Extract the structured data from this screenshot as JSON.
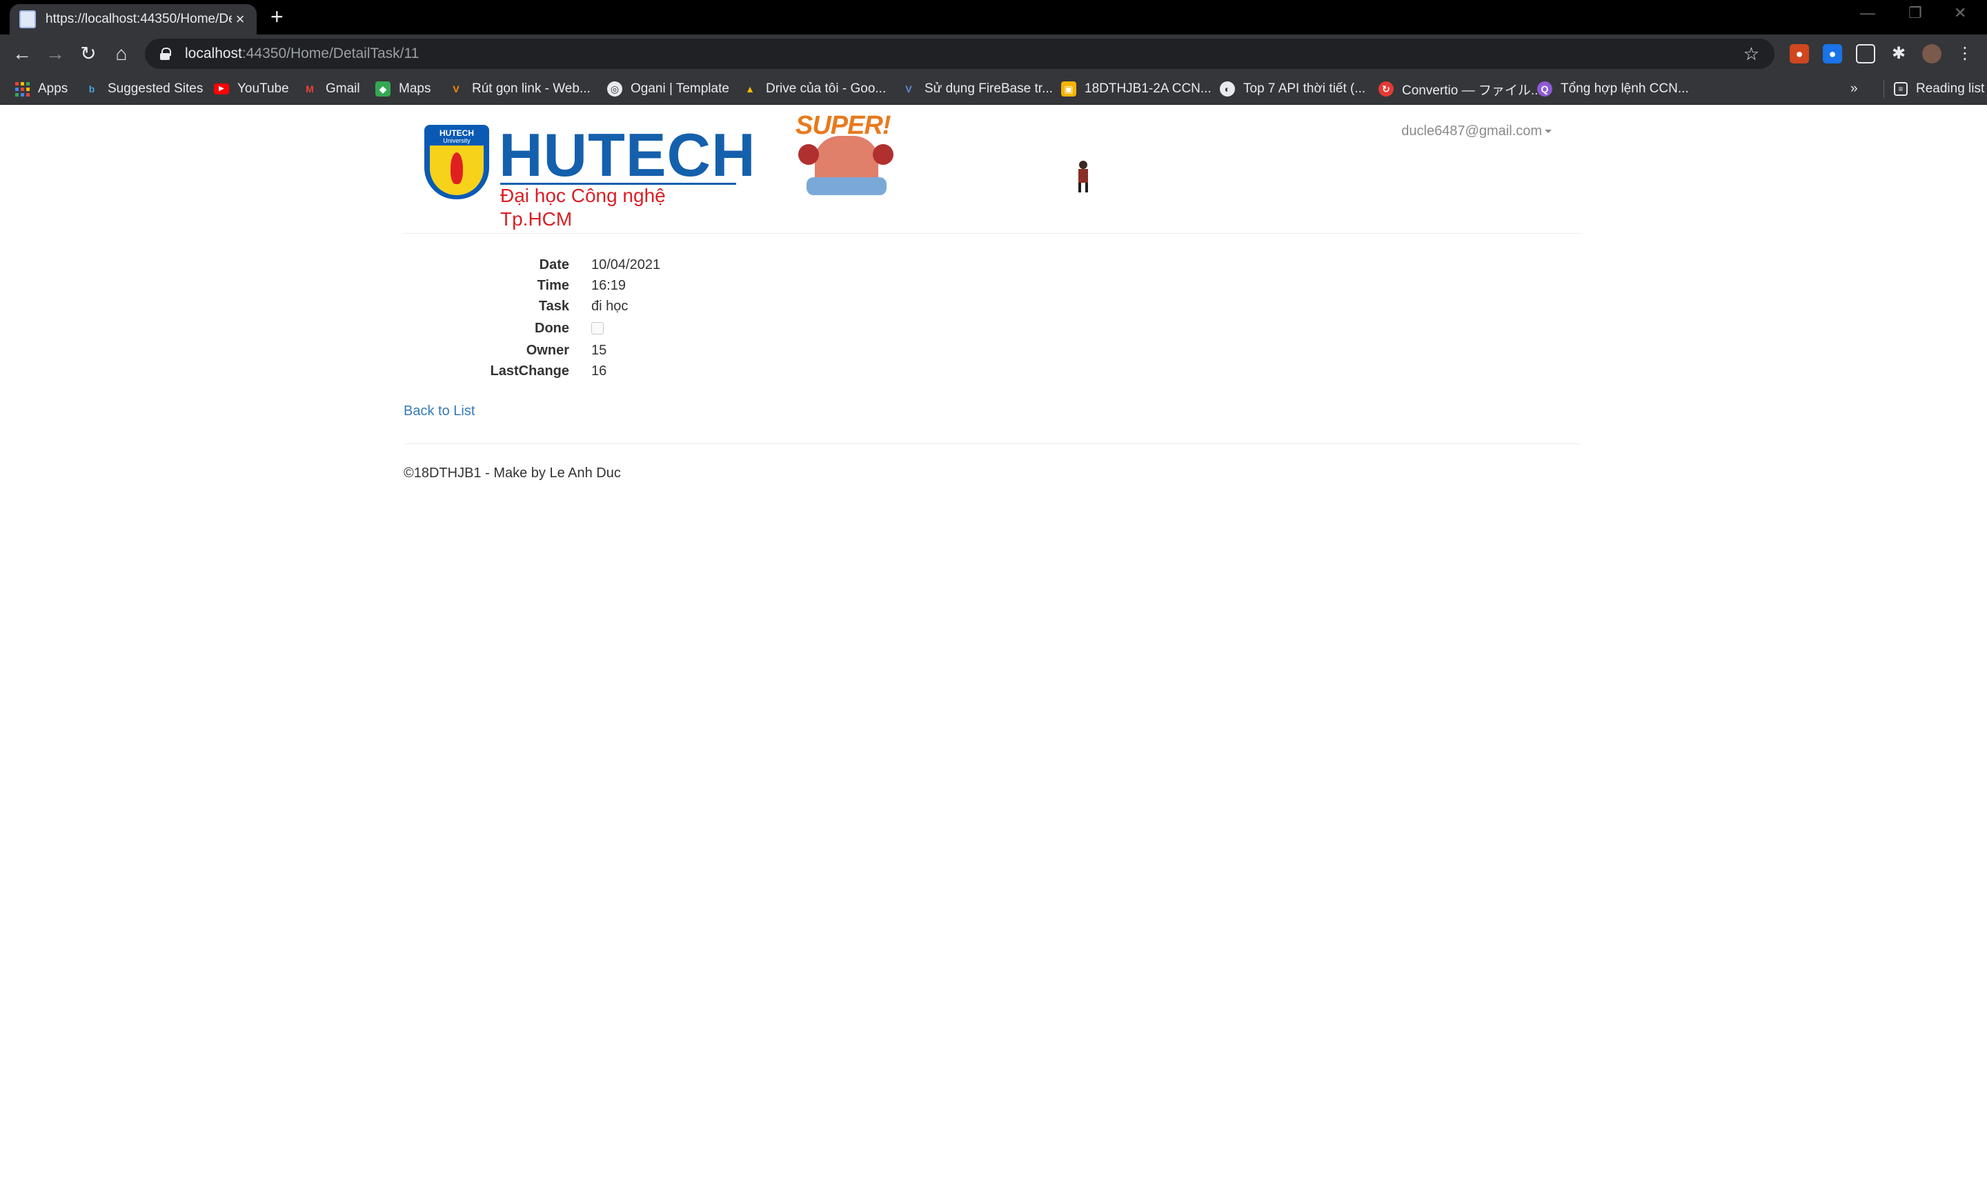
{
  "browser": {
    "tab_title": "https://localhost:44350/Home/DetailTask/11",
    "url_host": "localhost",
    "url_rest": ":44350/Home/DetailTask/11",
    "bookmarks": [
      {
        "label": "Apps",
        "icon": "apps-grid-icon"
      },
      {
        "label": "Suggested Sites",
        "icon": "bing-icon"
      },
      {
        "label": "YouTube",
        "icon": "youtube-icon"
      },
      {
        "label": "Gmail",
        "icon": "gmail-icon"
      },
      {
        "label": "Maps",
        "icon": "maps-icon"
      },
      {
        "label": "Rút gọn link - Web...",
        "icon": "v-logo-icon"
      },
      {
        "label": "Ogani | Template",
        "icon": "globe-icon"
      },
      {
        "label": "Drive của tôi - Goo...",
        "icon": "drive-icon"
      },
      {
        "label": "Sử dụng FireBase tr...",
        "icon": "v-logo-icon"
      },
      {
        "label": "18DTHJB1-2A CCN...",
        "icon": "classroom-icon"
      },
      {
        "label": "Top 7 API thời tiết (...",
        "icon": "circle-logo-icon"
      },
      {
        "label": "Convertio — ファイル...",
        "icon": "convertio-icon"
      },
      {
        "label": "Tổng hợp lệnh CCN...",
        "icon": "purple-logo-icon"
      }
    ],
    "overflow_label": "»",
    "reading_list_label": "Reading list"
  },
  "header": {
    "logo_title": "HUTECH",
    "logo_subtitle": "Đại học Công nghệ Tp.HCM",
    "logo_shield_title": "HUTECH",
    "logo_shield_sub": "University",
    "super_text": "SUPER!",
    "user_email": "ducle6487@gmail.com"
  },
  "details": [
    {
      "label": "Date",
      "value": "10/04/2021"
    },
    {
      "label": "Time",
      "value": "16:19"
    },
    {
      "label": "Task",
      "value": "đi học"
    },
    {
      "label": "Done",
      "value": ""
    },
    {
      "label": "Owner",
      "value": "15"
    },
    {
      "label": "LastChange",
      "value": "16"
    }
  ],
  "done_checked": false,
  "back_link": "Back to List",
  "footer": "©18DTHJB1 - Make by Le Anh Duc",
  "colors": {
    "link": "#337ab7",
    "brand_blue": "#1560ad",
    "brand_red": "#d81f26"
  }
}
